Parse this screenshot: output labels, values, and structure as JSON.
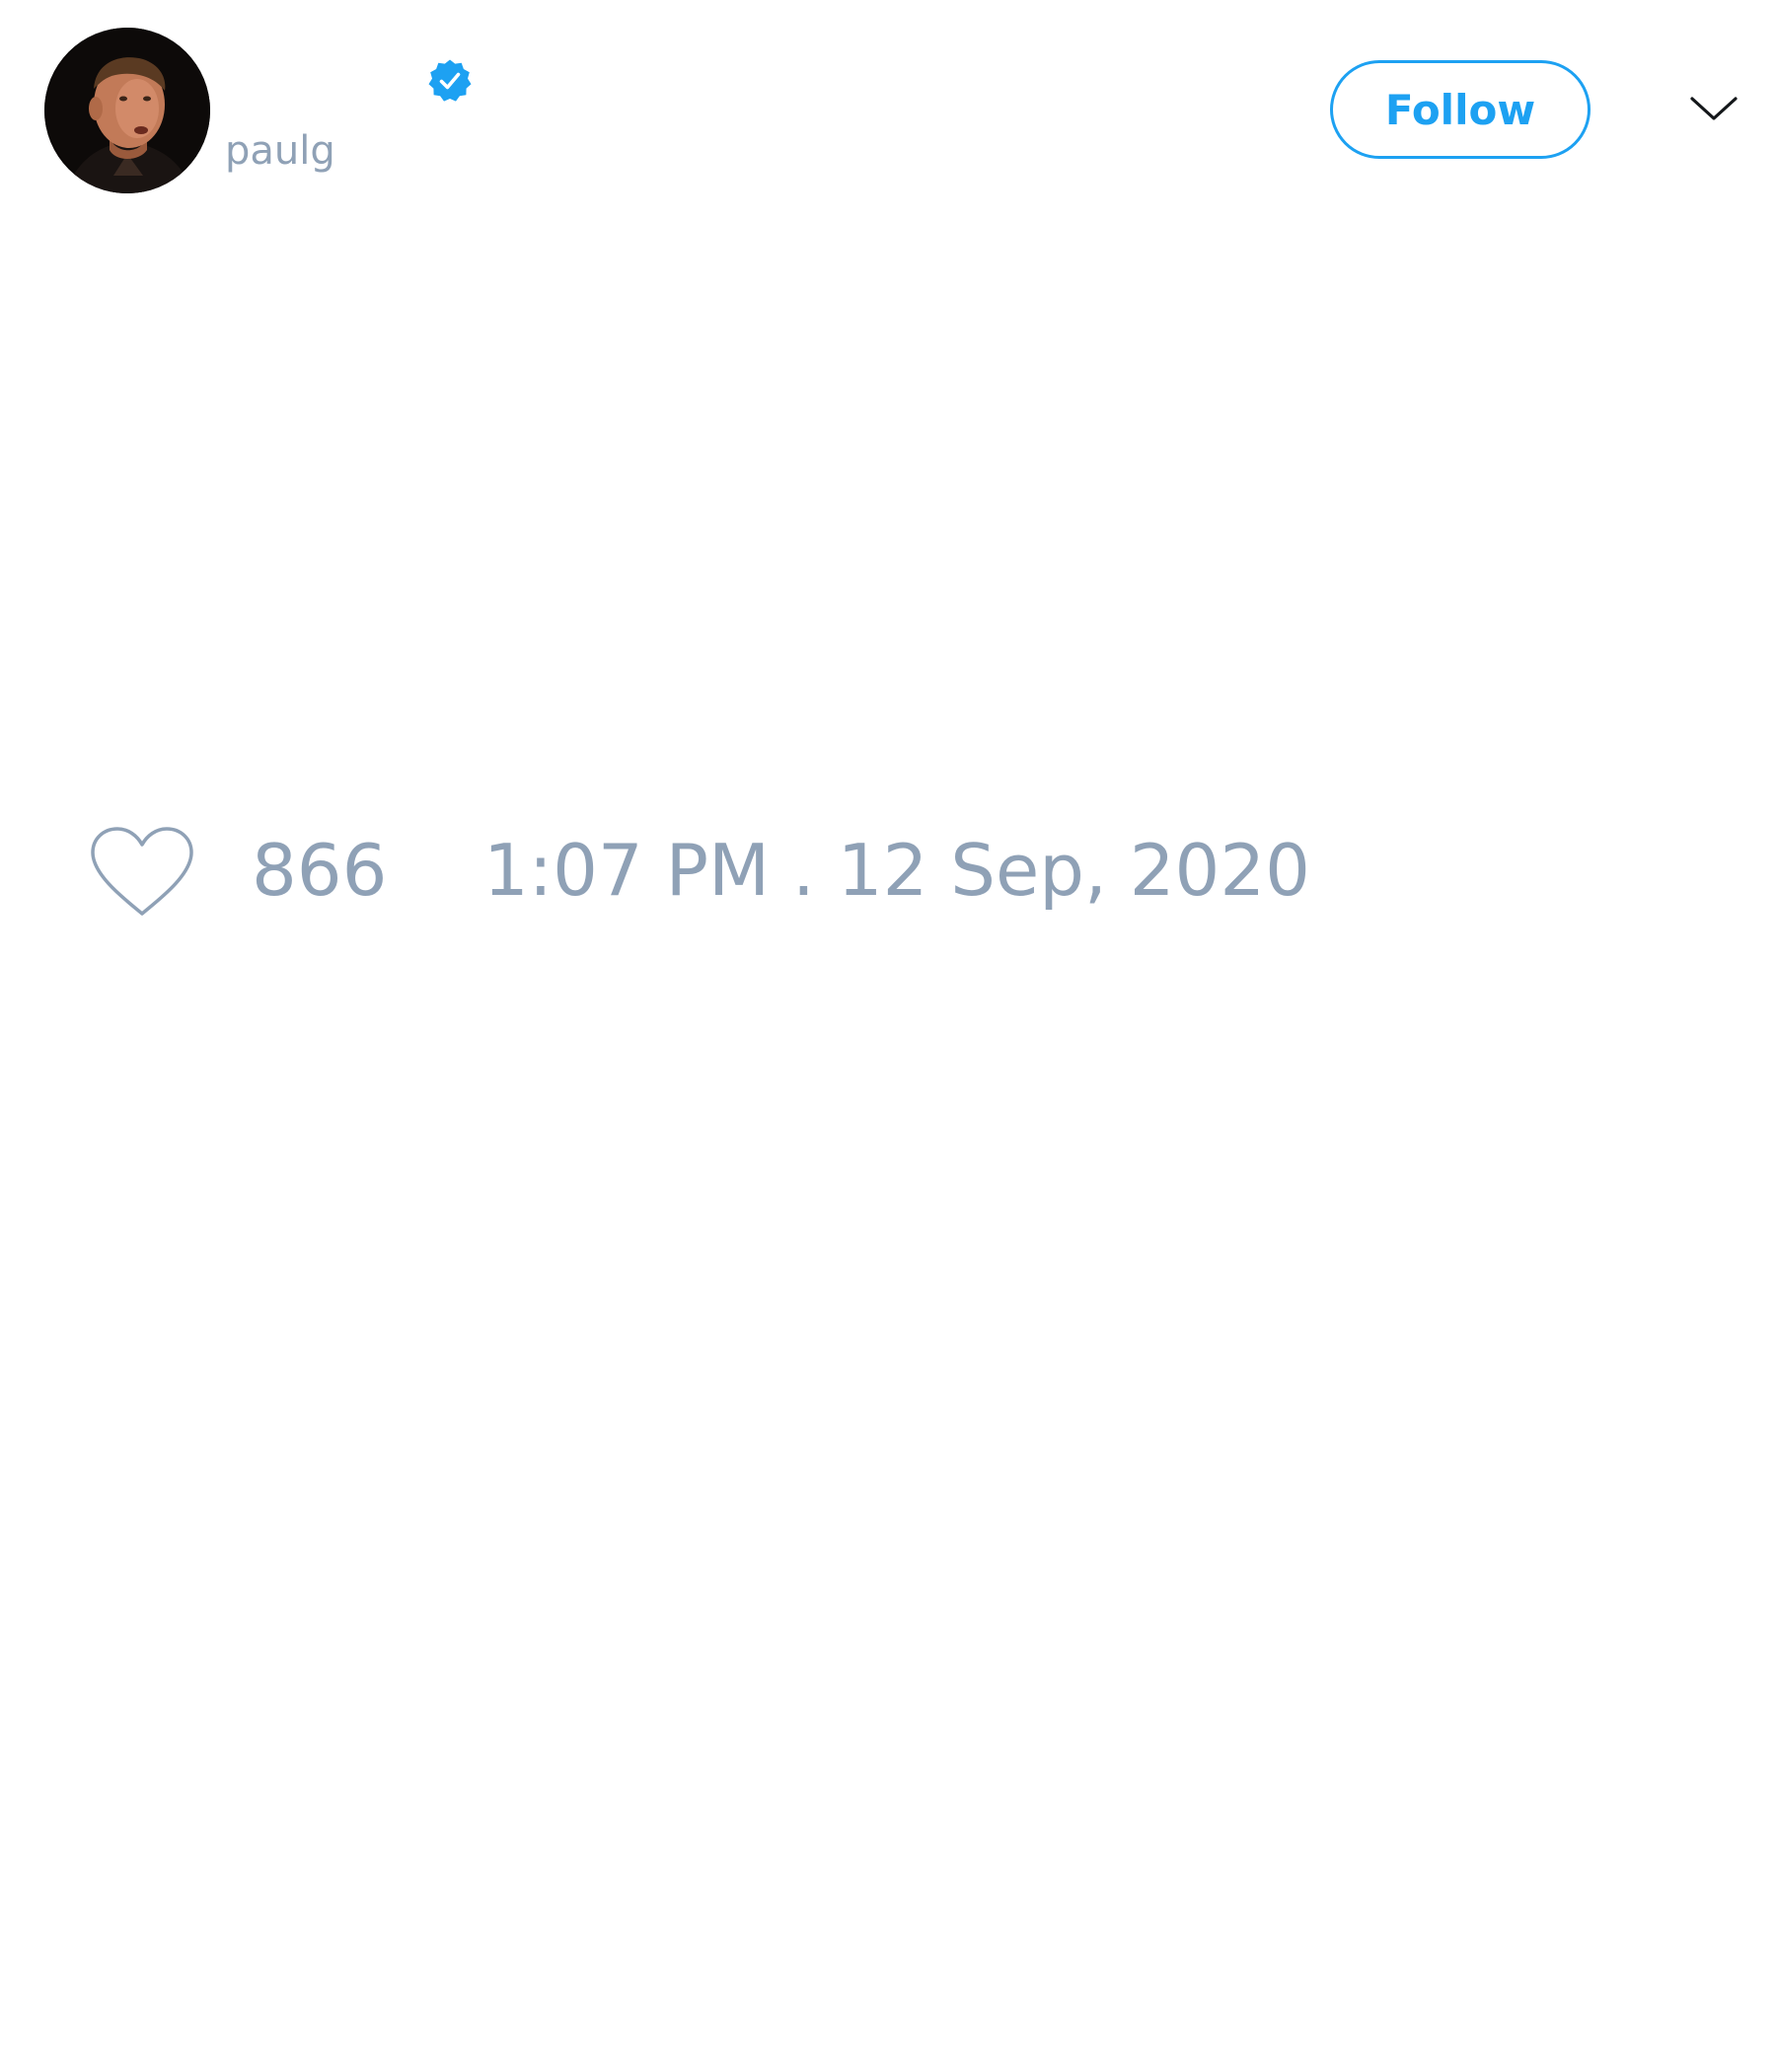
{
  "author": {
    "display_name": "",
    "handle": "paulg",
    "verified": true,
    "avatar_icon": "user-avatar"
  },
  "actions": {
    "follow_label": "Follow",
    "menu_icon": "chevron-down-icon"
  },
  "tweet": {
    "text": "",
    "like_count": "866",
    "timestamp": "1:07 PM . 12 Sep, 2020",
    "like_icon": "heart-icon"
  },
  "colors": {
    "accent": "#1da1f2",
    "muted_text": "#8fa1b6",
    "background": "#ffffff"
  }
}
